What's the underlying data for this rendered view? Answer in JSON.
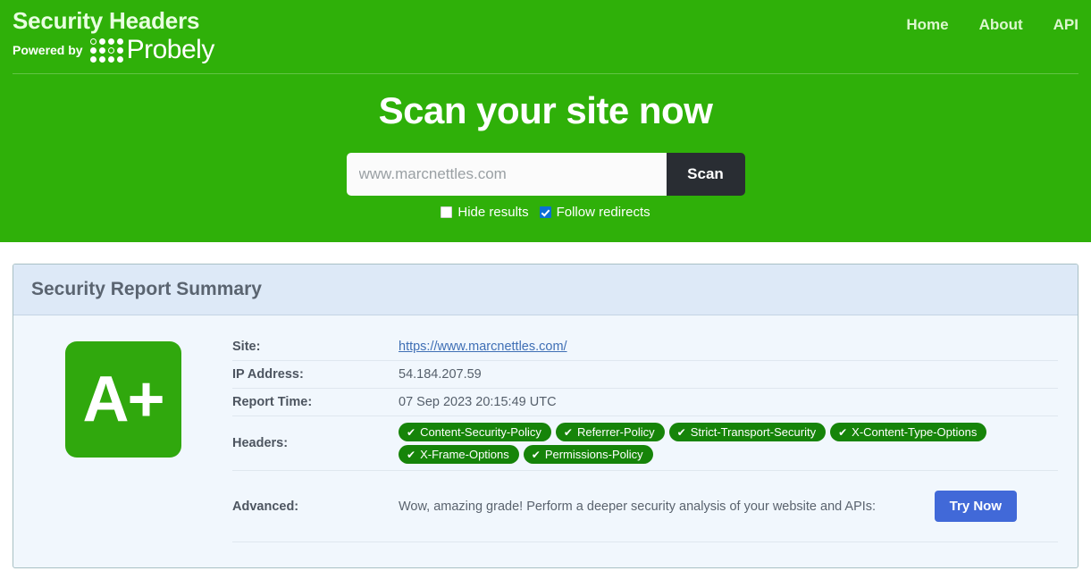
{
  "header": {
    "brand_title": "Security Headers",
    "powered_label": "Powered by",
    "logo_word": "Probely",
    "logo_icon": "probely-dot-grid-icon",
    "nav": [
      {
        "label": "Home"
      },
      {
        "label": "About"
      },
      {
        "label": "API"
      }
    ]
  },
  "hero": {
    "title": "Scan your site now",
    "search": {
      "placeholder": "www.marcnettles.com",
      "value": "",
      "button_label": "Scan"
    },
    "options": [
      {
        "label": "Hide results",
        "checked": false
      },
      {
        "label": "Follow redirects",
        "checked": true
      }
    ]
  },
  "report": {
    "card_title": "Security Report Summary",
    "grade": "A+",
    "rows": [
      {
        "label": "Site:",
        "value": "https://www.marcnettles.com/",
        "is_link": true
      },
      {
        "label": "IP Address:",
        "value": "54.184.207.59",
        "is_link": false
      },
      {
        "label": "Report Time:",
        "value": "07 Sep 2023 20:15:49 UTC",
        "is_link": false
      }
    ],
    "headers_label": "Headers:",
    "headers_badges": [
      "Content-Security-Policy",
      "Referrer-Policy",
      "Strict-Transport-Security",
      "X-Content-Type-Options",
      "X-Frame-Options",
      "Permissions-Policy"
    ],
    "badge_tick": "✔",
    "advanced_label": "Advanced:",
    "advanced_text": "Wow, amazing grade! Perform a deeper security analysis of your website and APIs:",
    "advanced_button": "Try Now"
  },
  "colors": {
    "brand_green": "#2fb009",
    "grade_green": "#30a80d",
    "badge_green": "#168409",
    "scan_dark": "#292d33",
    "try_blue": "#4169d8",
    "link_blue": "#3f6fb5",
    "card_head_blue": "#dde9f7",
    "card_body_blue": "#f1f7fd"
  }
}
